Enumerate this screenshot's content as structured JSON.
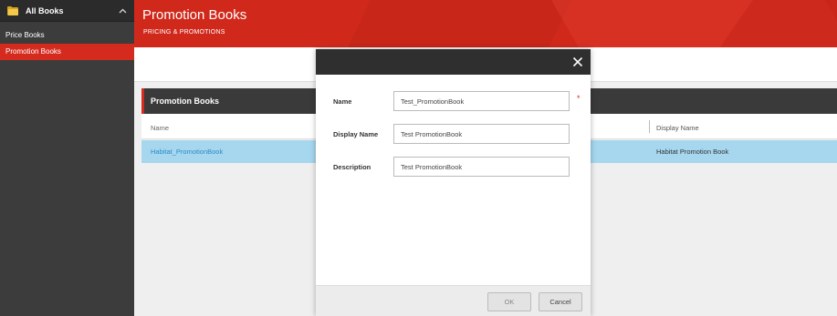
{
  "sidebar": {
    "title": "All Books",
    "items": [
      {
        "label": "Price Books",
        "active": false
      },
      {
        "label": "Promotion Books",
        "active": true
      }
    ]
  },
  "header": {
    "title": "Promotion Books",
    "subtitle": "PRICING & PROMOTIONS"
  },
  "panel": {
    "title": "Promotion Books",
    "columns": [
      "Name",
      "Display Name"
    ],
    "rows": [
      {
        "name": "Habitat_PromotionBook",
        "display_name": "Habitat Promotion Book"
      }
    ]
  },
  "modal": {
    "fields": [
      {
        "label": "Name",
        "value": "Test_PromotionBook",
        "required": true
      },
      {
        "label": "Display Name",
        "value": "Test PromotionBook",
        "required": false
      },
      {
        "label": "Description",
        "value": "Test PromotionBook",
        "required": false
      }
    ],
    "required_marker": "*",
    "ok_label": "OK",
    "cancel_label": "Cancel"
  },
  "colors": {
    "accent": "#d52b1e",
    "selected_row": "#a6d7ef",
    "link": "#2a8ac8",
    "dark": "#3a3a3a"
  }
}
